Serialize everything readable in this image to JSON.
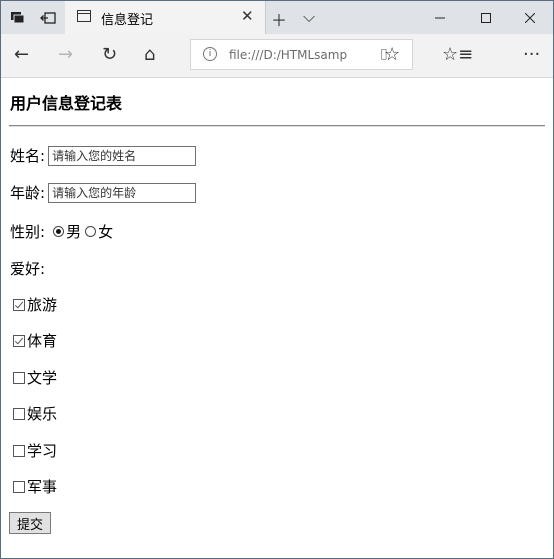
{
  "browser": {
    "tab_title": "信息登记",
    "address": "file:///D:/HTMLsamp",
    "address_placeholder": ""
  },
  "form": {
    "title": "用户信息登记表",
    "name_label": "姓名:",
    "name_placeholder": "请输入您的姓名",
    "age_label": "年龄:",
    "age_placeholder": "请输入您的年龄",
    "gender_label": "性别:",
    "gender_options": [
      {
        "label": "男",
        "selected": true
      },
      {
        "label": "女",
        "selected": false
      }
    ],
    "hobby_label": "爱好:",
    "hobbies": [
      {
        "label": "旅游",
        "checked": true
      },
      {
        "label": "体育",
        "checked": true
      },
      {
        "label": "文学",
        "checked": false
      },
      {
        "label": "娱乐",
        "checked": false
      },
      {
        "label": "学习",
        "checked": false
      },
      {
        "label": "军事",
        "checked": false
      }
    ],
    "submit_label": "提交"
  }
}
